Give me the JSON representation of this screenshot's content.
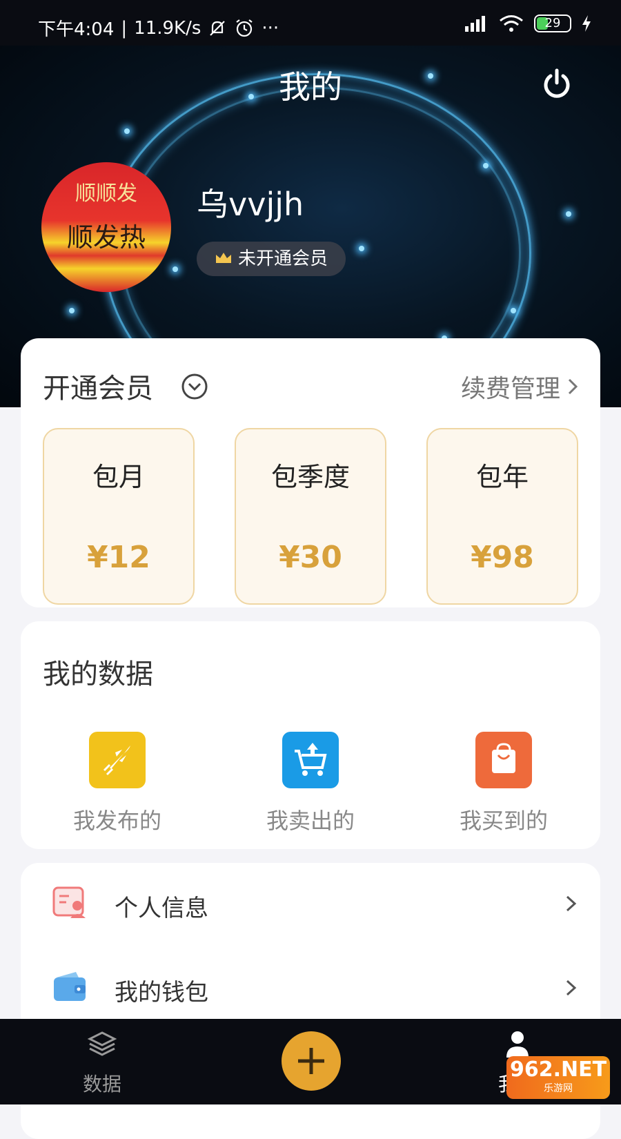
{
  "status_bar": {
    "time": "下午4:04",
    "net_speed": "11.9K/s",
    "extra": "···",
    "battery": "29"
  },
  "header": {
    "title": "我的",
    "username": "乌vvjjh",
    "vip_status": "未开通会员",
    "avatar_text_top": "顺顺发",
    "avatar_text_main": "顺发热"
  },
  "membership": {
    "title": "开通会员",
    "renew_label": "续费管理",
    "plans": [
      {
        "name": "包月",
        "price": "¥12"
      },
      {
        "name": "包季度",
        "price": "¥30"
      },
      {
        "name": "包年",
        "price": "¥98"
      }
    ],
    "accent": "#d8a13b"
  },
  "my_data": {
    "title": "我的数据",
    "items": [
      {
        "label": "我发布的",
        "icon": "rocket-icon",
        "color": "#f2c21b"
      },
      {
        "label": "我卖出的",
        "icon": "cart-upload-icon",
        "color": "#1a9be6"
      },
      {
        "label": "我买到的",
        "icon": "shopping-bag-icon",
        "color": "#ee6a3b"
      }
    ]
  },
  "menu": {
    "items": [
      {
        "label": "个人信息",
        "icon": "profile-card-icon"
      },
      {
        "label": "我的钱包",
        "icon": "wallet-icon"
      }
    ]
  },
  "tabbar": {
    "left_label": "数据",
    "right_label": "我的",
    "fab_color": "#e6a42f"
  },
  "watermark": {
    "brand": "962.NET",
    "sub": "乐游网"
  }
}
